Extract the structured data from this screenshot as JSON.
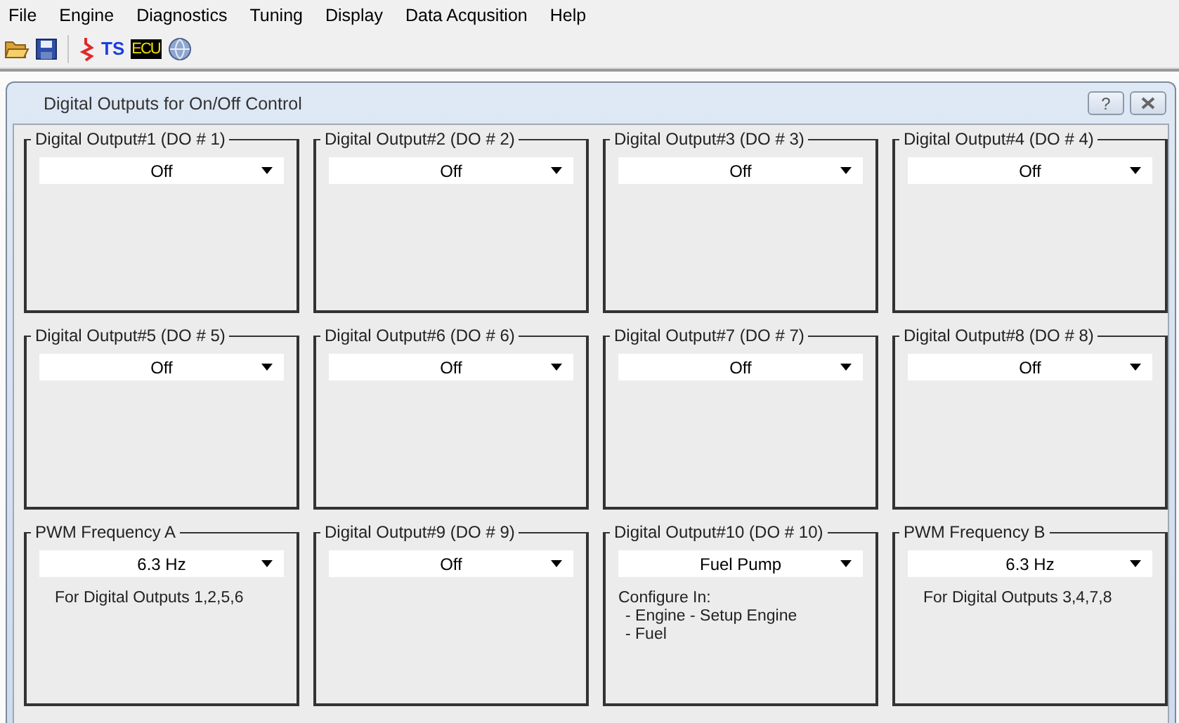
{
  "menu": [
    "File",
    "Engine",
    "Diagnostics",
    "Tuning",
    "Display",
    "Data Acqusition",
    "Help"
  ],
  "toolbar": [
    {
      "kind": "open"
    },
    {
      "kind": "save"
    },
    {
      "kind": "separator"
    },
    {
      "kind": "zigzag"
    },
    {
      "kind": "ts",
      "text": "TS"
    },
    {
      "kind": "ecu",
      "text": "ECU"
    },
    {
      "kind": "globe"
    }
  ],
  "window": {
    "title": "Digital Outputs for On/Off Control",
    "help": "?"
  },
  "groups": [
    {
      "title": "Digital Output#1 (DO # 1)",
      "value": "Off"
    },
    {
      "title": "Digital Output#2 (DO # 2)",
      "value": "Off"
    },
    {
      "title": "Digital Output#3 (DO # 3)",
      "value": "Off"
    },
    {
      "title": "Digital Output#4 (DO # 4)",
      "value": "Off"
    },
    {
      "title": "Digital Output#5 (DO # 5)",
      "value": "Off"
    },
    {
      "title": "Digital Output#6 (DO # 6)",
      "value": "Off"
    },
    {
      "title": "Digital Output#7 (DO # 7)",
      "value": "Off"
    },
    {
      "title": "Digital Output#8 (DO # 8)",
      "value": "Off"
    },
    {
      "title": "PWM Frequency A",
      "value": "6.3 Hz",
      "notes": [
        {
          "text": "For Digital Outputs 1,2,5,6"
        }
      ]
    },
    {
      "title": "Digital Output#9 (DO # 9)",
      "value": "Off"
    },
    {
      "title": "Digital Output#10 (DO # 10)",
      "value": "Fuel Pump",
      "notes": [
        {
          "text": "Configure In:",
          "children": [
            {
              "text": "- Engine - Setup Engine"
            },
            {
              "text": "- Fuel"
            }
          ]
        }
      ]
    },
    {
      "title": "PWM Frequency B",
      "value": "6.3 Hz",
      "notes": [
        {
          "text": "For Digital Outputs 3,4,7,8"
        }
      ]
    }
  ]
}
